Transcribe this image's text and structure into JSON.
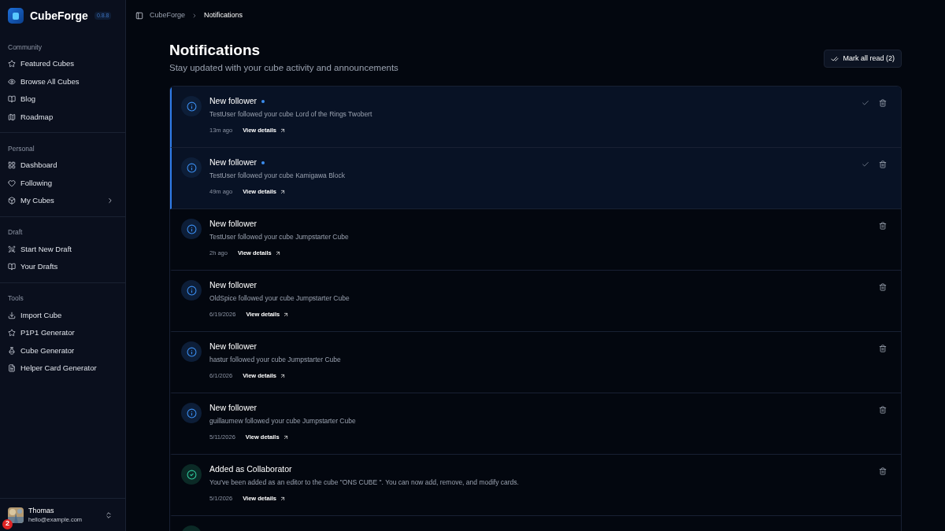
{
  "app": {
    "name": "CubeForge",
    "version": "0.8.8"
  },
  "breadcrumb": [
    "CubeForge",
    "Notifications"
  ],
  "sidebar": {
    "sections": [
      {
        "label": "Community",
        "items": [
          {
            "label": "Featured Cubes",
            "expandable": false
          },
          {
            "label": "Browse All Cubes",
            "expandable": false
          },
          {
            "label": "Blog",
            "expandable": false
          },
          {
            "label": "Roadmap",
            "expandable": false
          }
        ]
      },
      {
        "label": "Personal",
        "items": [
          {
            "label": "Dashboard",
            "expandable": false
          },
          {
            "label": "Following",
            "expandable": false
          },
          {
            "label": "My Cubes",
            "expandable": true
          }
        ]
      },
      {
        "label": "Draft",
        "items": [
          {
            "label": "Start New Draft",
            "expandable": false
          },
          {
            "label": "Your Drafts",
            "expandable": false
          }
        ]
      },
      {
        "label": "Tools",
        "items": [
          {
            "label": "Import Cube",
            "expandable": false
          },
          {
            "label": "P1P1 Generator",
            "expandable": false
          },
          {
            "label": "Cube Generator",
            "expandable": false
          },
          {
            "label": "Helper Card Generator",
            "expandable": false
          }
        ]
      }
    ],
    "user": {
      "name": "Thomas",
      "email": "hello@example.com",
      "badge": "2"
    }
  },
  "page": {
    "title": "Notifications",
    "subtitle": "Stay updated with your cube activity and announcements",
    "mark_all_button": "Mark all read (2)"
  },
  "notifications": [
    {
      "kind": "info",
      "title": "New follower",
      "message": "TestUser followed your cube Lord of the Rings Twobert",
      "time": "13m ago",
      "link": "View details",
      "unread": true
    },
    {
      "kind": "info",
      "title": "New follower",
      "message": "TestUser followed your cube Kamigawa Block",
      "time": "49m ago",
      "link": "View details",
      "unread": true
    },
    {
      "kind": "info",
      "title": "New follower",
      "message": "TestUser followed your cube Jumpstarter Cube",
      "time": "2h ago",
      "link": "View details",
      "unread": false
    },
    {
      "kind": "info",
      "title": "New follower",
      "message": "OldSpice followed your cube Jumpstarter Cube",
      "time": "6/19/2026",
      "link": "View details",
      "unread": false
    },
    {
      "kind": "info",
      "title": "New follower",
      "message": "hastur followed your cube Jumpstarter Cube",
      "time": "6/1/2026",
      "link": "View details",
      "unread": false
    },
    {
      "kind": "info",
      "title": "New follower",
      "message": "guillaumew followed your cube Jumpstarter Cube",
      "time": "5/11/2026",
      "link": "View details",
      "unread": false
    },
    {
      "kind": "success",
      "title": "Added as Collaborator",
      "message": "You've been added as an editor to the cube \"ONS CUBE \". You can now add, remove, and modify cards.",
      "time": "5/1/2026",
      "link": "View details",
      "unread": false
    }
  ]
}
